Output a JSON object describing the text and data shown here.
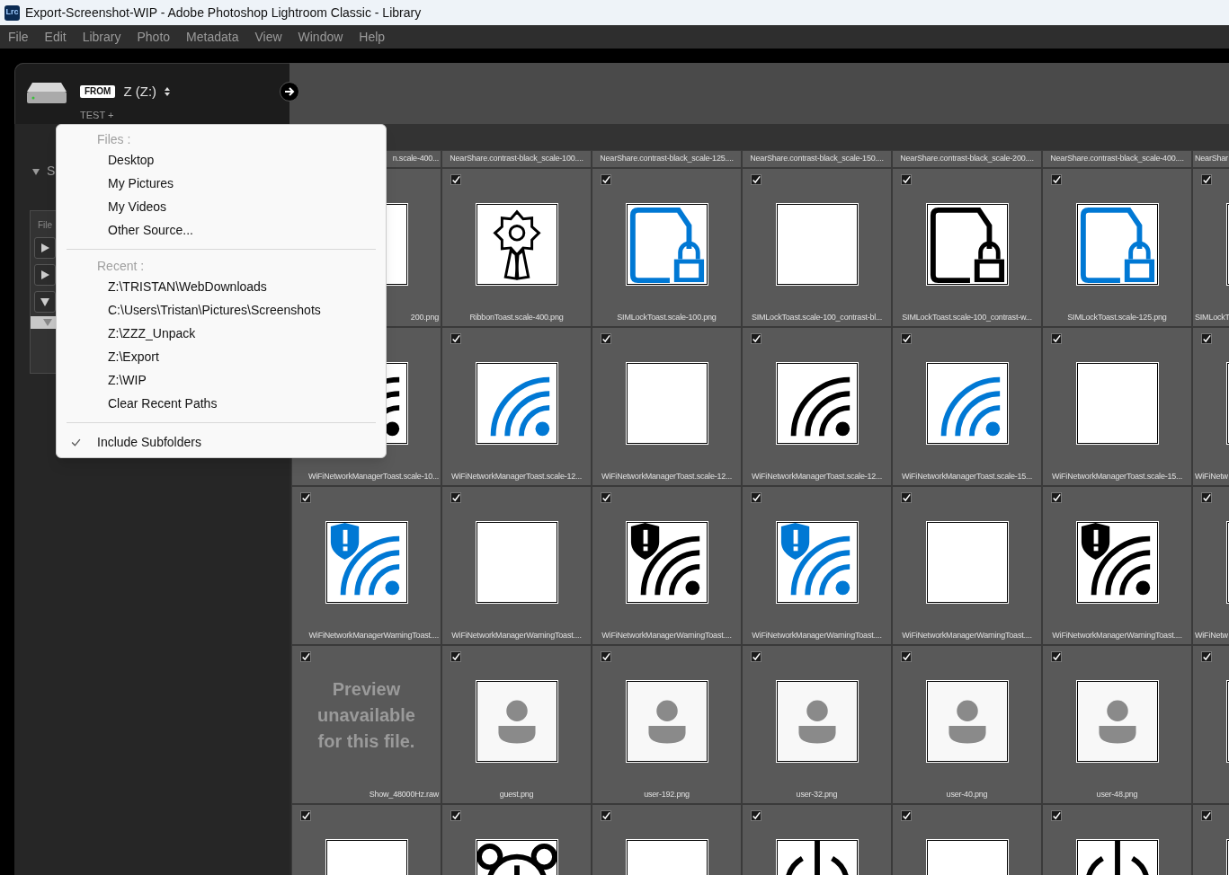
{
  "window": {
    "app_icon": "Lrc",
    "title": "Export-Screenshot-WIP - Adobe Photoshop Lightroom Classic - Library"
  },
  "menu_bar": [
    "File",
    "Edit",
    "Library",
    "Photo",
    "Metadata",
    "View",
    "Window",
    "Help"
  ],
  "source_panel": {
    "badge": "FROM",
    "volume": "Z (Z:)",
    "subtitle": "TEST +",
    "section_label": "S",
    "tab_label": "File"
  },
  "source_menu": {
    "groups": [
      {
        "header": "Files :",
        "items": [
          {
            "label": "Desktop",
            "checked": false
          },
          {
            "label": "My Pictures",
            "checked": false
          },
          {
            "label": "My Videos",
            "checked": false
          },
          {
            "label": "Other Source...",
            "checked": false
          }
        ]
      },
      {
        "header": "Recent :",
        "items": [
          {
            "label": "Z:\\TRISTAN\\WebDownloads",
            "checked": false
          },
          {
            "label": "C:\\Users\\Tristan\\Pictures\\Screenshots",
            "checked": false
          },
          {
            "label": "Z:\\ZZZ_Unpack",
            "checked": false
          },
          {
            "label": "Z:\\Export",
            "checked": false
          },
          {
            "label": "Z:\\WIP",
            "checked": false
          },
          {
            "label": "Clear Recent Paths",
            "checked": false
          }
        ]
      },
      {
        "items": [
          {
            "label": "Include Subfolders",
            "checked": true
          }
        ]
      }
    ]
  },
  "grid": {
    "label_strip": [
      "n.scale-400...",
      "NearShare.contrast-black_scale-100....",
      "NearShare.contrast-black_scale-125....",
      "NearShare.contrast-black_scale-150....",
      "NearShare.contrast-black_scale-200....",
      "NearShare.contrast-black_scale-400....",
      "NearShar"
    ],
    "rows": [
      {
        "cells": [
          {
            "thumbnail": {
              "kind": "blank"
            },
            "label": "200.png"
          },
          {
            "checked": true,
            "thumbnail": {
              "kind": "ribbon"
            },
            "label": "RibbonToast.scale-400.png"
          },
          {
            "checked": true,
            "thumbnail": {
              "kind": "file_lock",
              "color": "#0078d4"
            },
            "label": "SIMLockToast.scale-100.png"
          },
          {
            "checked": true,
            "thumbnail": {
              "kind": "blank"
            },
            "label": "SIMLockToast.scale-100_contrast-bl..."
          },
          {
            "checked": true,
            "thumbnail": {
              "kind": "file_lock",
              "color": "#000000"
            },
            "label": "SIMLockToast.scale-100_contrast-w..."
          },
          {
            "checked": true,
            "thumbnail": {
              "kind": "file_lock",
              "color": "#0078d4"
            },
            "label": "SIMLockToast.scale-125.png"
          },
          {
            "checked": true,
            "thumbnail": {
              "kind": "blank"
            },
            "label": "SIMLockT"
          }
        ]
      },
      {
        "cells": [
          {
            "thumbnail": {
              "kind": "wifi",
              "color": "#000000"
            },
            "label": "WiFiNetworkManagerToast.scale-10..."
          },
          {
            "checked": true,
            "thumbnail": {
              "kind": "wifi",
              "color": "#0078d4"
            },
            "label": "WiFiNetworkManagerToast.scale-12..."
          },
          {
            "checked": true,
            "thumbnail": {
              "kind": "blank"
            },
            "label": "WiFiNetworkManagerToast.scale-12..."
          },
          {
            "checked": true,
            "thumbnail": {
              "kind": "wifi",
              "color": "#000000"
            },
            "label": "WiFiNetworkManagerToast.scale-12..."
          },
          {
            "checked": true,
            "thumbnail": {
              "kind": "wifi",
              "color": "#0078d4"
            },
            "label": "WiFiNetworkManagerToast.scale-15..."
          },
          {
            "checked": true,
            "thumbnail": {
              "kind": "blank"
            },
            "label": "WiFiNetworkManagerToast.scale-15..."
          },
          {
            "checked": true,
            "thumbnail": {
              "kind": "blank"
            },
            "label": "WiFiNetw"
          }
        ]
      },
      {
        "cells": [
          {
            "checked": true,
            "thumbnail": {
              "kind": "wifi_warning",
              "color": "#0078d4"
            },
            "label": "WiFiNetworkManagerWarningToast...."
          },
          {
            "checked": true,
            "thumbnail": {
              "kind": "blank"
            },
            "label": "WiFiNetworkManagerWarningToast...."
          },
          {
            "checked": true,
            "thumbnail": {
              "kind": "wifi_warning",
              "color": "#000000"
            },
            "label": "WiFiNetworkManagerWarningToast...."
          },
          {
            "checked": true,
            "thumbnail": {
              "kind": "wifi_warning",
              "color": "#0078d4"
            },
            "label": "WiFiNetworkManagerWarningToast...."
          },
          {
            "checked": true,
            "thumbnail": {
              "kind": "blank"
            },
            "label": "WiFiNetworkManagerWarningToast...."
          },
          {
            "checked": true,
            "thumbnail": {
              "kind": "wifi_warning",
              "color": "#000000"
            },
            "label": "WiFiNetworkManagerWarningToast...."
          },
          {
            "checked": true,
            "thumbnail": {
              "kind": "blank"
            },
            "label": "WiFiNetw"
          }
        ]
      },
      {
        "cells": [
          {
            "checked": true,
            "thumbnail": {
              "kind": "unavailable",
              "text": "Preview unavailable for this file."
            },
            "label": "Show_48000Hz.raw"
          },
          {
            "checked": true,
            "thumbnail": {
              "kind": "user"
            },
            "label": "guest.png"
          },
          {
            "checked": true,
            "thumbnail": {
              "kind": "user"
            },
            "label": "user-192.png"
          },
          {
            "checked": true,
            "thumbnail": {
              "kind": "user"
            },
            "label": "user-32.png"
          },
          {
            "checked": true,
            "thumbnail": {
              "kind": "user"
            },
            "label": "user-40.png"
          },
          {
            "checked": true,
            "thumbnail": {
              "kind": "user"
            },
            "label": "user-48.png"
          },
          {
            "checked": true,
            "thumbnail": {
              "kind": "blank"
            }
          }
        ]
      },
      {
        "cells": [
          {
            "checked": true,
            "thumbnail": {
              "kind": "blank"
            }
          },
          {
            "checked": true,
            "thumbnail": {
              "kind": "alarm"
            }
          },
          {
            "checked": true,
            "thumbnail": {
              "kind": "blank"
            }
          },
          {
            "checked": true,
            "thumbnail": {
              "kind": "power"
            }
          },
          {
            "checked": true,
            "thumbnail": {
              "kind": "blank"
            }
          },
          {
            "checked": true,
            "thumbnail": {
              "kind": "power"
            }
          },
          {
            "checked": true,
            "thumbnail": {
              "kind": "blank"
            }
          }
        ]
      }
    ]
  }
}
